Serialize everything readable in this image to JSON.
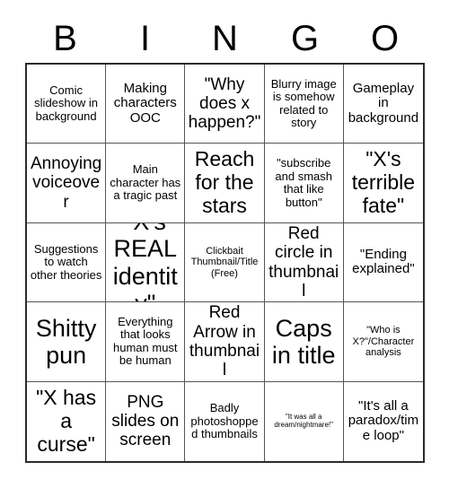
{
  "header": {
    "letters": [
      "B",
      "I",
      "N",
      "G",
      "O"
    ]
  },
  "grid": {
    "rows": 5,
    "columns": 5,
    "border_color": "#2b2b2b",
    "line_color": "#555555",
    "background": "#ffffff",
    "text_color": "#000000"
  },
  "cells": [
    {
      "text": "Comic slideshow in background",
      "size": "t-sm"
    },
    {
      "text": "Making characters OOC",
      "size": "t-md"
    },
    {
      "text": "\"Why does x happen?\"",
      "size": "t-lg"
    },
    {
      "text": "Blurry image is somehow related to story",
      "size": "t-sm"
    },
    {
      "text": "Gameplay in background",
      "size": "t-md"
    },
    {
      "text": "Annoying voiceover",
      "size": "t-lg"
    },
    {
      "text": "Main character has a tragic past",
      "size": "t-sm"
    },
    {
      "text": "Reach for the stars",
      "size": "t-xl"
    },
    {
      "text": "\"subscribe and smash that like button\"",
      "size": "t-sm"
    },
    {
      "text": "\"X's terrible fate\"",
      "size": "t-xl"
    },
    {
      "text": "Suggestions to watch other theories",
      "size": "t-sm"
    },
    {
      "text": "\"X's REAL identity\"",
      "size": "t-xxl"
    },
    {
      "text": "Clickbait Thumbnail/Title (Free)",
      "size": "t-xs"
    },
    {
      "text": "Red circle in thumbnail",
      "size": "t-lg"
    },
    {
      "text": "\"Ending explained\"",
      "size": "t-md"
    },
    {
      "text": "Shitty pun",
      "size": "t-xxl"
    },
    {
      "text": "Everything that looks human must be human",
      "size": "t-sm"
    },
    {
      "text": "Red Arrow in thumbnail",
      "size": "t-lg"
    },
    {
      "text": "Caps in title",
      "size": "t-xxl"
    },
    {
      "text": "\"Who is X?\"/Character analysis",
      "size": "t-xs"
    },
    {
      "text": "\"X has a curse\"",
      "size": "t-xl"
    },
    {
      "text": "PNG slides on screen",
      "size": "t-lg"
    },
    {
      "text": "Badly photoshopped thumbnails",
      "size": "t-sm"
    },
    {
      "text": "\"It was all a dream/nightmare!\"",
      "size": "t-xxs"
    },
    {
      "text": "\"It's all a paradox/time loop\"",
      "size": "t-md"
    }
  ]
}
